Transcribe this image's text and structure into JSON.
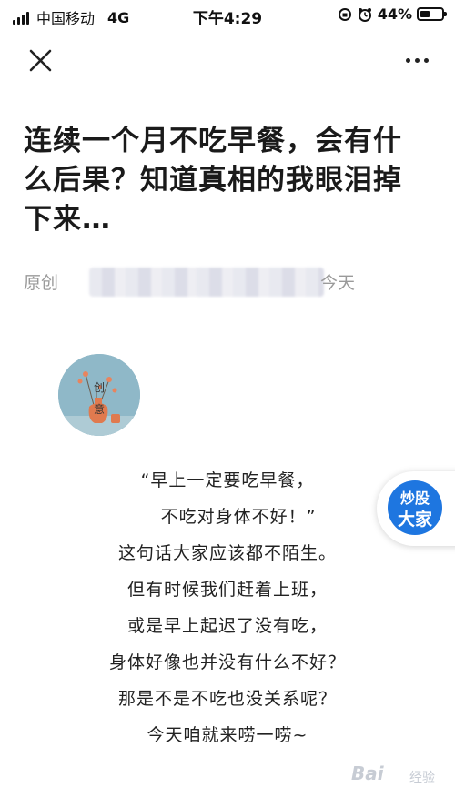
{
  "status_bar": {
    "carrier": "中国移动",
    "network": "4G",
    "time": "下午4:29",
    "battery": "44%",
    "battery_level": 0.44
  },
  "nav": {
    "close_icon": "close-icon",
    "more_icon": "more-icon"
  },
  "article": {
    "title": "连续一个月不吃早餐，会有什么后果？知道真相的我眼泪掉下来…",
    "meta_original": "原创",
    "meta_date": "今天",
    "avatar_chars": [
      "创",
      "意"
    ],
    "body_lines": [
      "“早上一定要吃早餐，",
      "不吃对身体不好！”",
      "这句话大家应该都不陌生。",
      "但有时候我们赶着上班，",
      "或是早上起迟了没有吃，",
      "身体好像也并没有什么不好？",
      "那是不是不吃也没关系呢？",
      "今天咱就来唠一唠~"
    ]
  },
  "float_badge": {
    "line1": "炒股",
    "line2": "大家"
  },
  "watermark": {
    "logo": "Bai",
    "sub": "经验"
  },
  "colors": {
    "meta_gray": "#9a9a9a",
    "badge_blue": "#1e76e0",
    "title": "#1a1a1a"
  }
}
